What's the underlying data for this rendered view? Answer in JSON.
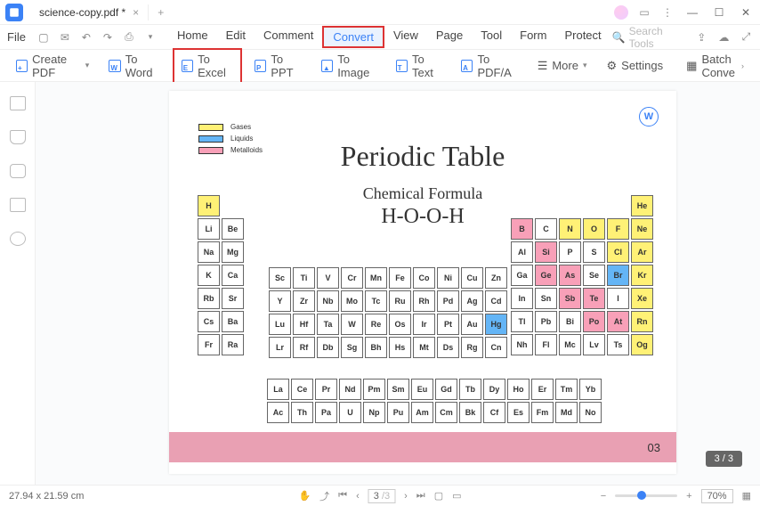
{
  "titlebar": {
    "filename": "science-copy.pdf *"
  },
  "menu": {
    "file": "File",
    "items": [
      "Home",
      "Edit",
      "Comment",
      "Convert",
      "View",
      "Page",
      "Tool",
      "Form",
      "Protect"
    ],
    "highlighted": "Convert",
    "search_placeholder": "Search Tools"
  },
  "toolbar": {
    "create": "Create PDF",
    "to_word": "To Word",
    "to_excel": "To Excel",
    "to_ppt": "To PPT",
    "to_image": "To Image",
    "to_text": "To Text",
    "to_pdfa": "To PDF/A",
    "more": "More",
    "settings": "Settings",
    "batch": "Batch Conve"
  },
  "page_indicator": "3 / 3",
  "status": {
    "dimensions": "27.94 x 21.59 cm",
    "page_current": "3",
    "page_total": "/3",
    "zoom": "70%"
  },
  "doc": {
    "title": "Periodic Table",
    "subtitle": "Chemical Formula",
    "formula": "H-O-O-H",
    "footer_num": "03",
    "legend": [
      {
        "label": "Gases",
        "color": "#fff176"
      },
      {
        "label": "Liquids",
        "color": "#64b5f6"
      },
      {
        "label": "Metalloids",
        "color": "#f8a0b8"
      }
    ],
    "word_badge": "W"
  },
  "chart_data": {
    "type": "table",
    "title": "Periodic Table",
    "left_block": [
      [
        {
          "s": "H",
          "c": "g"
        },
        {
          "s": ""
        }
      ],
      [
        {
          "s": "Li"
        },
        {
          "s": "Be"
        }
      ],
      [
        {
          "s": "Na"
        },
        {
          "s": "Mg"
        }
      ],
      [
        {
          "s": "K"
        },
        {
          "s": "Ca"
        }
      ],
      [
        {
          "s": "Rb"
        },
        {
          "s": "Sr"
        }
      ],
      [
        {
          "s": "Cs"
        },
        {
          "s": "Ba"
        }
      ],
      [
        {
          "s": "Fr"
        },
        {
          "s": "Ra"
        }
      ]
    ],
    "mid_block": [
      [
        {
          "s": "Sc"
        },
        {
          "s": "Ti"
        },
        {
          "s": "V"
        },
        {
          "s": "Cr"
        },
        {
          "s": "Mn"
        },
        {
          "s": "Fe"
        },
        {
          "s": "Co"
        },
        {
          "s": "Ni"
        },
        {
          "s": "Cu"
        },
        {
          "s": "Zn"
        }
      ],
      [
        {
          "s": "Y"
        },
        {
          "s": "Zr"
        },
        {
          "s": "Nb"
        },
        {
          "s": "Mo"
        },
        {
          "s": "Tc"
        },
        {
          "s": "Ru"
        },
        {
          "s": "Rh"
        },
        {
          "s": "Pd"
        },
        {
          "s": "Ag"
        },
        {
          "s": "Cd"
        }
      ],
      [
        {
          "s": "Lu"
        },
        {
          "s": "Hf"
        },
        {
          "s": "Ta"
        },
        {
          "s": "W"
        },
        {
          "s": "Re"
        },
        {
          "s": "Os"
        },
        {
          "s": "Ir"
        },
        {
          "s": "Pt"
        },
        {
          "s": "Au"
        },
        {
          "s": "Hg",
          "c": "l"
        }
      ],
      [
        {
          "s": "Lr"
        },
        {
          "s": "Rf"
        },
        {
          "s": "Db"
        },
        {
          "s": "Sg"
        },
        {
          "s": "Bh"
        },
        {
          "s": "Hs"
        },
        {
          "s": "Mt"
        },
        {
          "s": "Ds"
        },
        {
          "s": "Rg"
        },
        {
          "s": "Cn"
        }
      ]
    ],
    "right_block": [
      [
        {
          "s": ""
        },
        {
          "s": ""
        },
        {
          "s": ""
        },
        {
          "s": ""
        },
        {
          "s": ""
        },
        {
          "s": "He",
          "c": "g"
        }
      ],
      [
        {
          "s": "B",
          "c": "m"
        },
        {
          "s": "C"
        },
        {
          "s": "N",
          "c": "g"
        },
        {
          "s": "O",
          "c": "g"
        },
        {
          "s": "F",
          "c": "g"
        },
        {
          "s": "Ne",
          "c": "g"
        }
      ],
      [
        {
          "s": "Al"
        },
        {
          "s": "Si",
          "c": "m"
        },
        {
          "s": "P"
        },
        {
          "s": "S"
        },
        {
          "s": "Cl",
          "c": "g"
        },
        {
          "s": "Ar",
          "c": "g"
        }
      ],
      [
        {
          "s": "Ga"
        },
        {
          "s": "Ge",
          "c": "m"
        },
        {
          "s": "As",
          "c": "m"
        },
        {
          "s": "Se"
        },
        {
          "s": "Br",
          "c": "l"
        },
        {
          "s": "Kr",
          "c": "g"
        }
      ],
      [
        {
          "s": "In"
        },
        {
          "s": "Sn"
        },
        {
          "s": "Sb",
          "c": "m"
        },
        {
          "s": "Te",
          "c": "m"
        },
        {
          "s": "I"
        },
        {
          "s": "Xe",
          "c": "g"
        }
      ],
      [
        {
          "s": "Tl"
        },
        {
          "s": "Pb"
        },
        {
          "s": "Bi"
        },
        {
          "s": "Po",
          "c": "m"
        },
        {
          "s": "At",
          "c": "m"
        },
        {
          "s": "Rn",
          "c": "g"
        }
      ],
      [
        {
          "s": "Nh"
        },
        {
          "s": "Fl"
        },
        {
          "s": "Mc"
        },
        {
          "s": "Lv"
        },
        {
          "s": "Ts"
        },
        {
          "s": "Og",
          "c": "g"
        }
      ]
    ],
    "bottom_block": [
      [
        {
          "s": "La"
        },
        {
          "s": "Ce"
        },
        {
          "s": "Pr"
        },
        {
          "s": "Nd"
        },
        {
          "s": "Pm"
        },
        {
          "s": "Sm"
        },
        {
          "s": "Eu"
        },
        {
          "s": "Gd"
        },
        {
          "s": "Tb"
        },
        {
          "s": "Dy"
        },
        {
          "s": "Ho"
        },
        {
          "s": "Er"
        },
        {
          "s": "Tm"
        },
        {
          "s": "Yb"
        }
      ],
      [
        {
          "s": "Ac"
        },
        {
          "s": "Th"
        },
        {
          "s": "Pa"
        },
        {
          "s": "U"
        },
        {
          "s": "Np"
        },
        {
          "s": "Pu"
        },
        {
          "s": "Am"
        },
        {
          "s": "Cm"
        },
        {
          "s": "Bk"
        },
        {
          "s": "Cf"
        },
        {
          "s": "Es"
        },
        {
          "s": "Fm"
        },
        {
          "s": "Md"
        },
        {
          "s": "No"
        }
      ]
    ]
  }
}
